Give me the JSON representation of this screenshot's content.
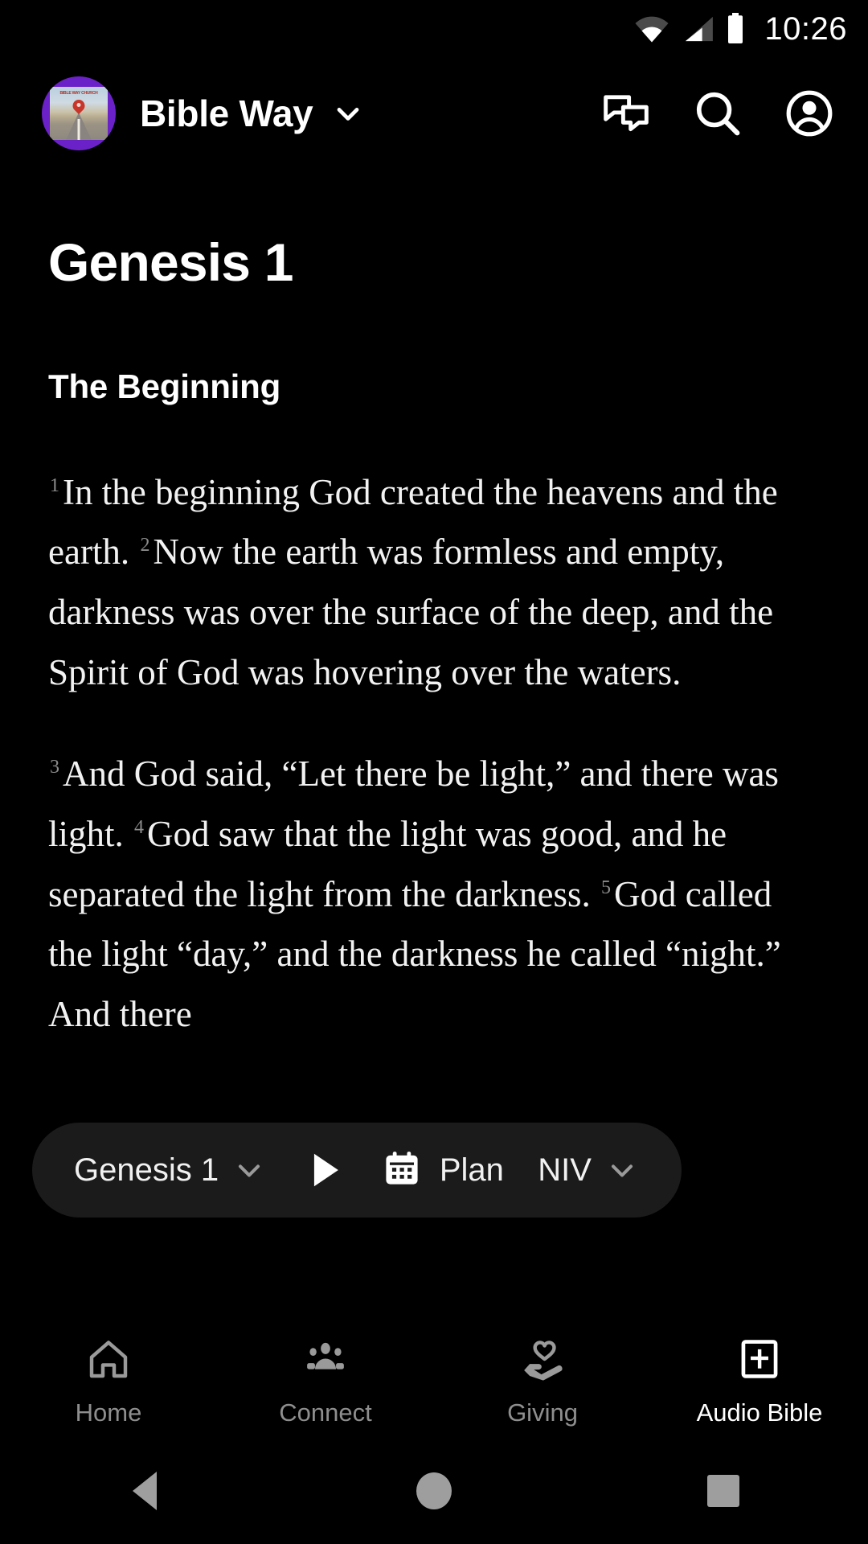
{
  "status_bar": {
    "time": "10:26",
    "icons": [
      "wifi-icon",
      "cellular-signal-icon",
      "battery-icon"
    ]
  },
  "app_bar": {
    "logo_alt": "Bible Way Church logo",
    "logo_art_text": "BIBLE WAY CHURCH",
    "logo_bg_color": "#6b21c8",
    "title": "Bible Way",
    "title_chevron": "chevron-down-icon",
    "actions": [
      {
        "name": "messages-icon",
        "label": "Messages"
      },
      {
        "name": "search-icon",
        "label": "Search"
      },
      {
        "name": "account-icon",
        "label": "Account"
      }
    ]
  },
  "reader": {
    "chapter_title": "Genesis 1",
    "section_heading": "The Beginning",
    "paragraphs": [
      {
        "verses": [
          {
            "number": "1",
            "text": "In the beginning God created the heavens and the earth."
          },
          {
            "number": "2",
            "text": "Now the earth was formless and empty, darkness was over the surface of the deep, and the Spirit of God was hovering over the waters."
          }
        ]
      },
      {
        "verses": [
          {
            "number": "3",
            "text": "And God said, “Let there be light,” and there was light."
          },
          {
            "number": "4",
            "text": "God saw that the light was good, and he separated the light from the darkness."
          },
          {
            "number": "5",
            "text": "God called the light “day,” and the darkness he called “night.” And there"
          }
        ]
      }
    ],
    "verse_number_color": "#8c8c8c"
  },
  "pill_bar": {
    "background": "#1b1b1b",
    "chapter_selector": {
      "label": "Genesis 1",
      "chevron": "chevron-down-icon"
    },
    "play_button": "play-icon",
    "plan_button": {
      "icon": "calendar-icon",
      "label": "Plan"
    },
    "version_selector": {
      "label": "NIV",
      "chevron": "chevron-down-icon"
    }
  },
  "bottom_nav": {
    "active_color": "#ffffff",
    "inactive_color": "#8e8e8e",
    "items": [
      {
        "label": "Home",
        "icon": "home-icon",
        "active": false
      },
      {
        "label": "Connect",
        "icon": "people-group-icon",
        "active": false
      },
      {
        "label": "Giving",
        "icon": "hand-heart-icon",
        "active": false
      },
      {
        "label": "Audio Bible",
        "icon": "bible-book-icon",
        "active": true
      }
    ]
  },
  "system_nav": {
    "items": [
      {
        "label": "Back",
        "icon": "triangle-back-icon"
      },
      {
        "label": "Home",
        "icon": "circle-home-icon"
      },
      {
        "label": "Recents",
        "icon": "square-recents-icon"
      }
    ]
  }
}
